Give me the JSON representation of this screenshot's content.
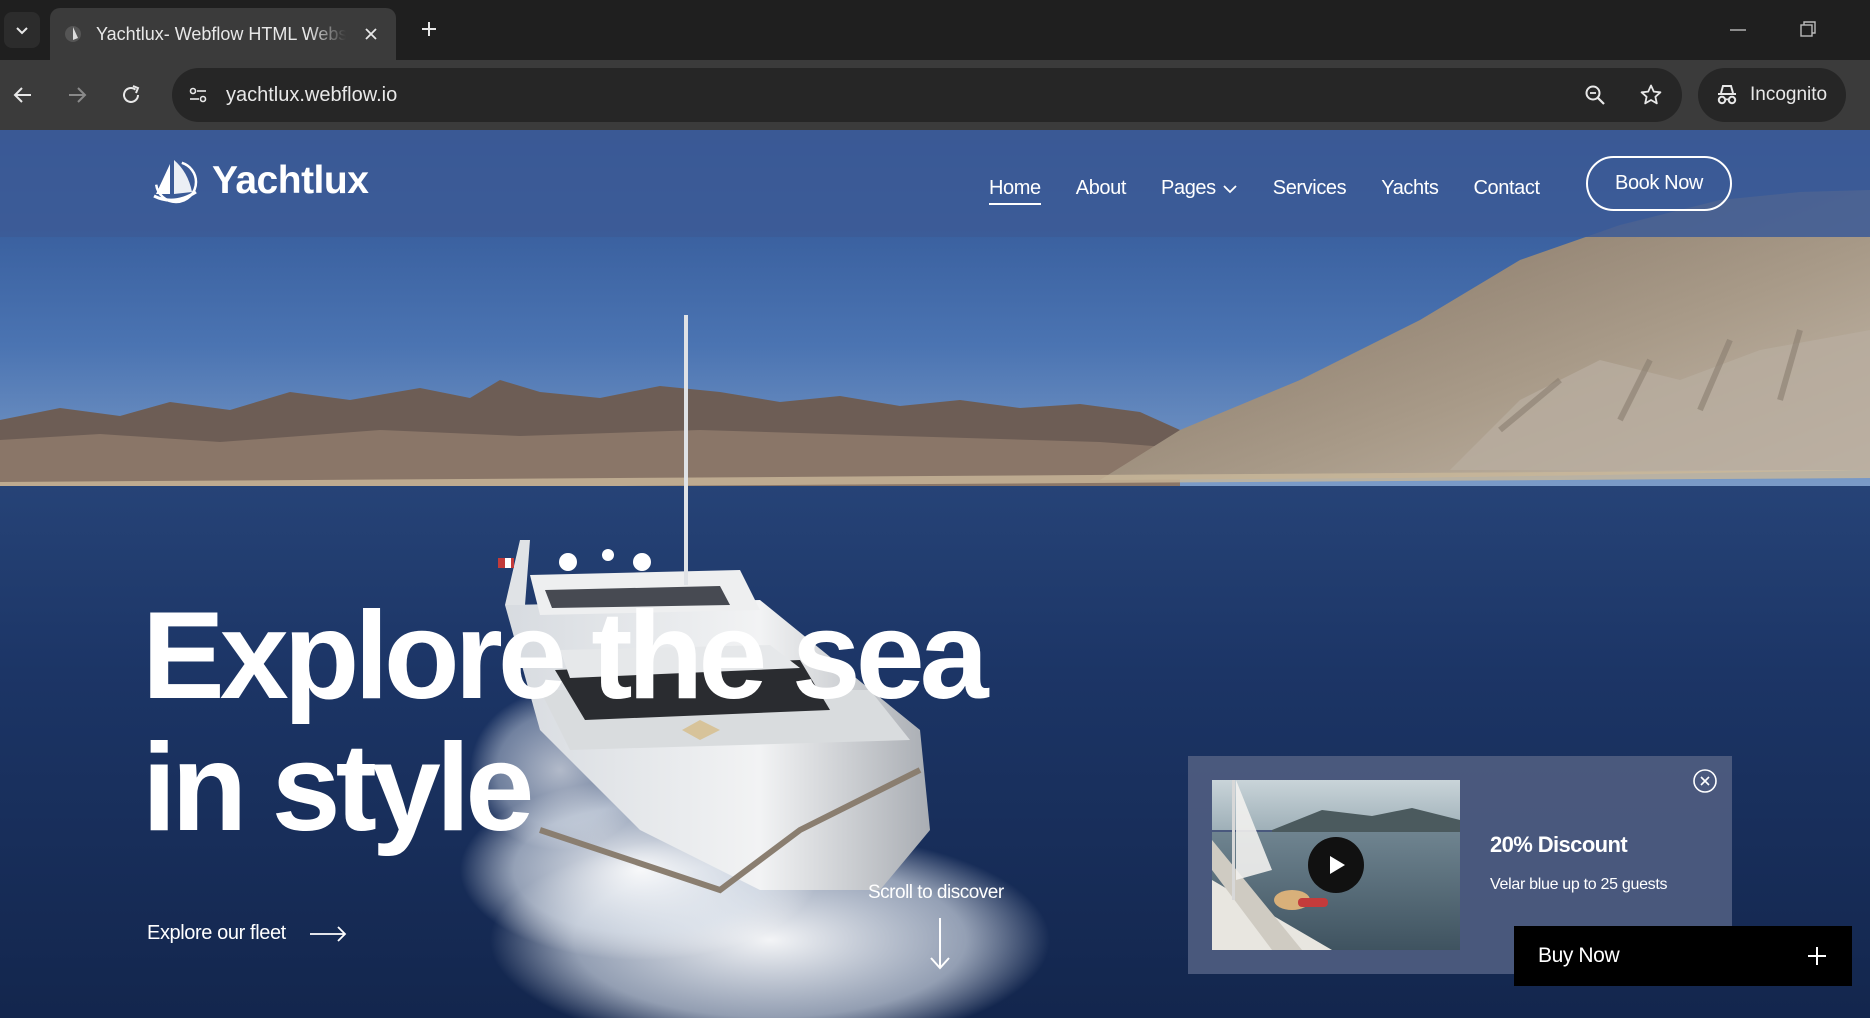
{
  "browser": {
    "tab_title": "Yachtlux- Webflow HTML Website Template",
    "url": "yachtlux.webflow.io",
    "profile_label": "Incognito",
    "icons": [
      "tab-search-icon",
      "close-icon",
      "plus-icon",
      "minimize-icon",
      "restore-icon",
      "back-icon",
      "forward-icon",
      "reload-icon",
      "site-info-icon",
      "zoom-icon",
      "star-icon",
      "incognito-icon"
    ]
  },
  "site": {
    "brand": "Yachtlux",
    "nav": [
      {
        "label": "Home",
        "active": true
      },
      {
        "label": "About"
      },
      {
        "label": "Pages",
        "has_dropdown": true
      },
      {
        "label": "Services"
      },
      {
        "label": "Yachts"
      },
      {
        "label": "Contact"
      }
    ],
    "cta": "Book Now"
  },
  "hero": {
    "headline": "Explore the sea\nin style",
    "explore_link": "Explore our fleet",
    "scroll_hint": "Scroll to discover"
  },
  "promo": {
    "title": "20% Discount",
    "subtitle": "Velar blue up to 25 guests"
  },
  "buy_button": "Buy Now",
  "colors": {
    "header_bg": "#3d5b96",
    "sky_top": "#2e5392",
    "sea": "#1a3568",
    "promo_bg": "#4e5c80",
    "buy_bg": "#000000"
  }
}
